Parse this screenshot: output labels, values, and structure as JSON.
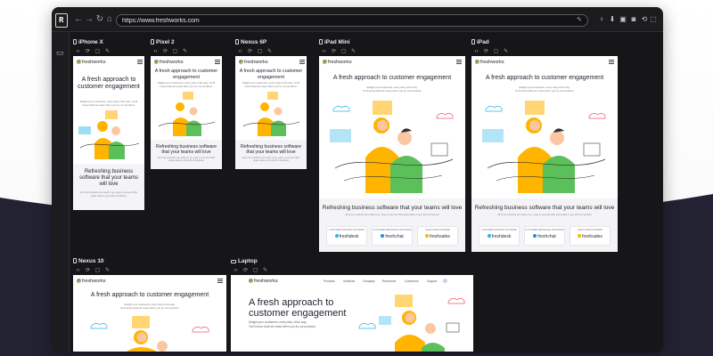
{
  "browser": {
    "url": "https://www.freshworks.com",
    "nav": {
      "back": "←",
      "forward": "→",
      "reload": "↻",
      "home": "⌂"
    }
  },
  "devices": [
    {
      "name": "iPhone X"
    },
    {
      "name": "Pixel 2"
    },
    {
      "name": "Nexus 6P"
    },
    {
      "name": "iPad Mini"
    },
    {
      "name": "iPad"
    },
    {
      "name": "Nexus 10"
    },
    {
      "name": "Laptop"
    }
  ],
  "site": {
    "brand": "freshworks",
    "hero_title": "A fresh approach to customer engagement",
    "hero_sub_1": "Delight your customers, every step of the way.",
    "hero_sub_2": "You'll know what we mean when you try our products.",
    "band_title": "Refreshing business software that your teams will love",
    "band_sub": "All of our products are ready to go, easy to use and offer great value to any kind of business",
    "products": [
      {
        "caption": "CUSTOMER SUPPORT SOFTWARE",
        "name": "freshdesk",
        "color": "#26b5e9"
      },
      {
        "caption": "CUSTOMER MESSAGING SOFTWARE",
        "name": "freshchat",
        "color": "#1f8ceb"
      },
      {
        "caption": "SALES CRM SOFTWARE",
        "name": "freshsales",
        "color": "#ffb400"
      }
    ],
    "laptop_nav": [
      "Products",
      "Solutions",
      "Company",
      "Resources",
      "Customers",
      "Support"
    ]
  },
  "icons": {
    "toolbar": [
      "bulb-icon",
      "pin-icon",
      "lock-icon",
      "camera-icon",
      "sync-icon",
      "select-icon",
      "zoom-icon"
    ],
    "device_tools": [
      "code-icon",
      "rotate-icon",
      "screenshot-icon",
      "edit-icon"
    ]
  },
  "colors": {
    "app_bg": "#1c1c1f",
    "brand_yellow": "#ffb400",
    "brand_blue": "#26b5e9",
    "brand_green": "#5cc05a",
    "brand_red": "#f0536c"
  }
}
